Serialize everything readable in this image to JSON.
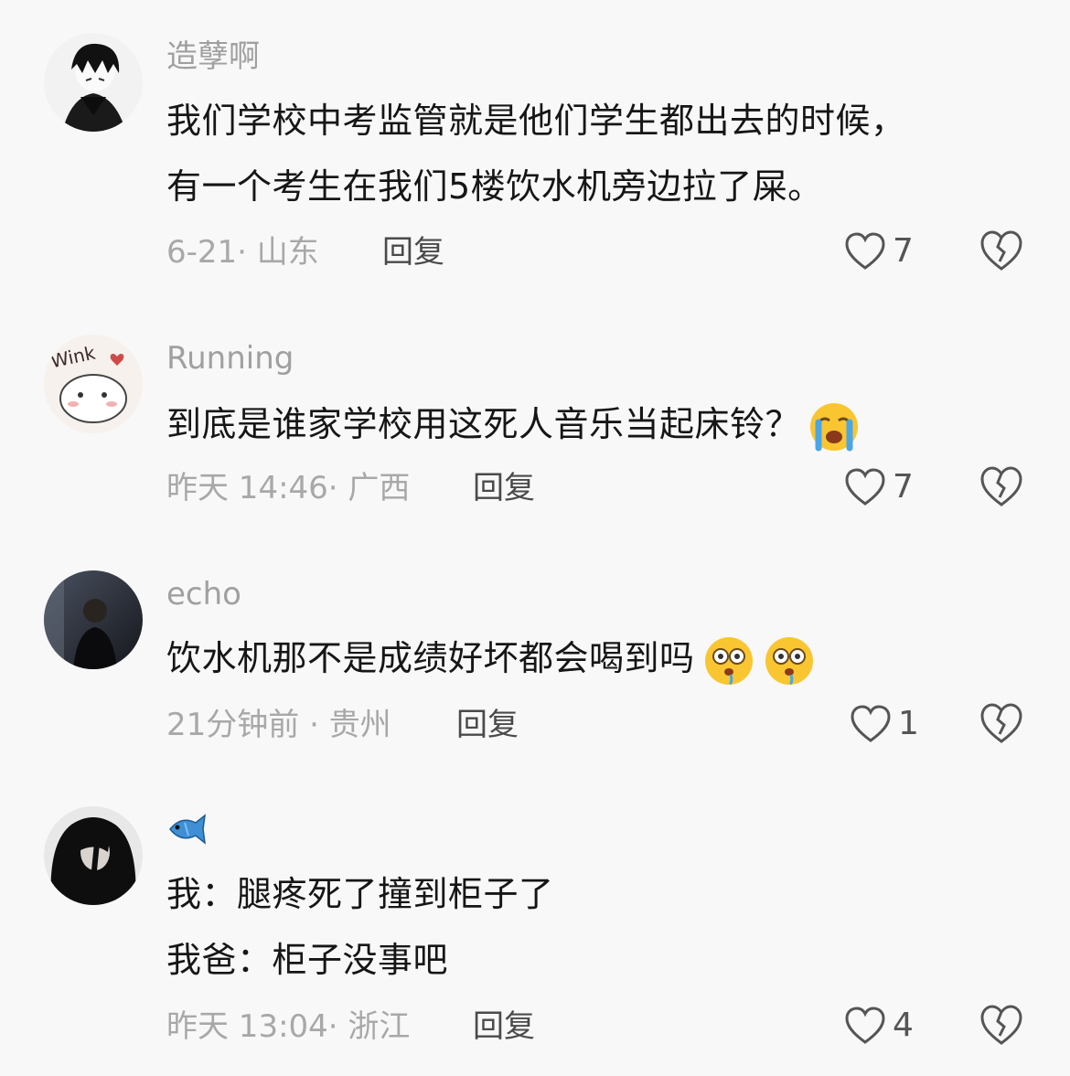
{
  "comments": [
    {
      "username": "造孽啊",
      "lines": [
        "我们学校中考监管就是他们学生都出去的时候，",
        "有一个考生在我们5楼饮水机旁边拉了屎。"
      ],
      "meta": "6-21· 山东",
      "reply": "回复",
      "likes": "7"
    },
    {
      "username": "Running",
      "lines": [
        "到底是谁家学校用这死人音乐当起床铃？"
      ],
      "meta": "昨天 14:46· 广西",
      "reply": "回复",
      "likes": "7"
    },
    {
      "username": "echo",
      "lines": [
        "饮水机那不是成绩好坏都会喝到吗"
      ],
      "meta": "21分钟前 · 贵州",
      "reply": "回复",
      "likes": "1"
    },
    {
      "username": "🐟",
      "lines": [
        "我：腿疼死了撞到柜子了",
        "我爸：柜子没事吧"
      ],
      "meta": "昨天 13:04· 浙江",
      "reply": "回复",
      "likes": "4"
    }
  ],
  "icons": {
    "like": "heart-outline-icon",
    "dislike": "broken-heart-icon",
    "emoji_crying": "loudly-crying-face-emoji",
    "emoji_flushed": "flushed-drooling-face-emoji",
    "username_fish": "fish-emoji"
  },
  "colors": {
    "background": "#f8f8f8",
    "text": "#161616",
    "meta": "#a8a8a8",
    "username": "#a0a0a0"
  }
}
